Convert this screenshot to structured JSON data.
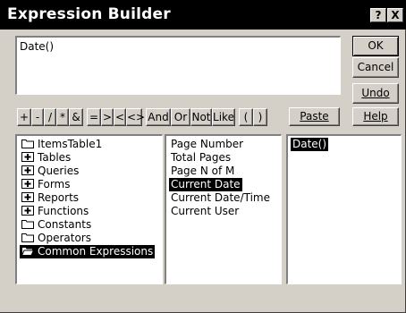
{
  "window": {
    "title": "Expression Builder",
    "help_button": "?",
    "close_button": "X"
  },
  "expression": {
    "value": "Date()"
  },
  "buttons": {
    "ok": "OK",
    "cancel": "Cancel",
    "undo": "Undo",
    "paste": "Paste",
    "help": "Help"
  },
  "operators": [
    "+",
    "-",
    "/",
    "*",
    "&",
    "=",
    ">",
    "<",
    "<>",
    "And",
    "Or",
    "Not",
    "Like",
    "(",
    ")"
  ],
  "left_list": {
    "items": [
      {
        "label": "ItemsTable1",
        "icon": "folder-icon"
      },
      {
        "label": "Tables",
        "icon": "expand-folder-icon"
      },
      {
        "label": "Queries",
        "icon": "expand-folder-icon"
      },
      {
        "label": "Forms",
        "icon": "expand-folder-icon"
      },
      {
        "label": "Reports",
        "icon": "expand-folder-icon"
      },
      {
        "label": "Functions",
        "icon": "expand-folder-icon"
      },
      {
        "label": "Constants",
        "icon": "folder-icon"
      },
      {
        "label": "Operators",
        "icon": "folder-icon"
      },
      {
        "label": "Common Expressions",
        "icon": "open-folder-icon",
        "selected": true
      }
    ]
  },
  "middle_list": {
    "items": [
      {
        "label": "Page Number"
      },
      {
        "label": "Total Pages"
      },
      {
        "label": "Page N of M"
      },
      {
        "label": "Current Date",
        "selected": true
      },
      {
        "label": "Current Date/Time"
      },
      {
        "label": "Current User"
      }
    ]
  },
  "right_list": {
    "items": [
      {
        "label": "Date()",
        "selected": true
      }
    ]
  }
}
